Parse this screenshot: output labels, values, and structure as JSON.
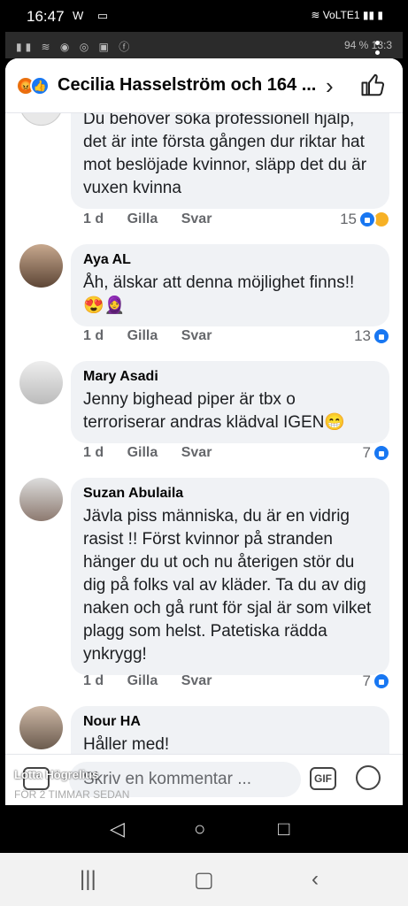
{
  "status": {
    "time": "16:47",
    "left_icons": "W ▭",
    "right_icons": "≋ VoLTE1 ▮▮ ▮"
  },
  "inner_status": {
    "left": "▮▮ ≋ ◉ ◎ ▣ ⓕ",
    "battery": "94 %",
    "time": "13:3"
  },
  "header": {
    "title": "Cecilia Hasselström och 164 ..."
  },
  "comments": [
    {
      "name": "",
      "text": "Du behöver söka professionell hjälp, det är inte första gången dur riktar hat mot beslöjade kvinnor, släpp det du är vuxen kvinna",
      "age": "1 d",
      "like": "Gilla",
      "reply": "Svar",
      "count": "15"
    },
    {
      "name": "Aya AL",
      "text": "Åh, älskar att denna möjlighet finns!! 😍🧕",
      "age": "1 d",
      "like": "Gilla",
      "reply": "Svar",
      "count": "13"
    },
    {
      "name": "Mary Asadi",
      "text": "Jenny bighead piper är tbx o terroriserar andras klädval IGEN😁",
      "age": "1 d",
      "like": "Gilla",
      "reply": "Svar",
      "count": "7"
    },
    {
      "name": "Suzan Abulaila",
      "text": "Jävla piss människa, du är en vidrig rasist !! Först kvinnor på stranden hänger du ut och nu återigen stör du dig på folks val av kläder. Ta du av dig naken och gå runt för sjal är som vilket plagg som helst. Patetiska rädda ynkrygg!",
      "age": "1 d",
      "like": "Gilla",
      "reply": "Svar",
      "count": "7"
    },
    {
      "name": "Nour HA",
      "text": "Håller med!"
    }
  ],
  "composer": {
    "placeholder": "Skriv en kommentar ...",
    "gif": "GIF"
  },
  "overlay": {
    "author": "Lotta Högrelius",
    "time": "FÖR 2 TIMMAR SEDAN"
  }
}
